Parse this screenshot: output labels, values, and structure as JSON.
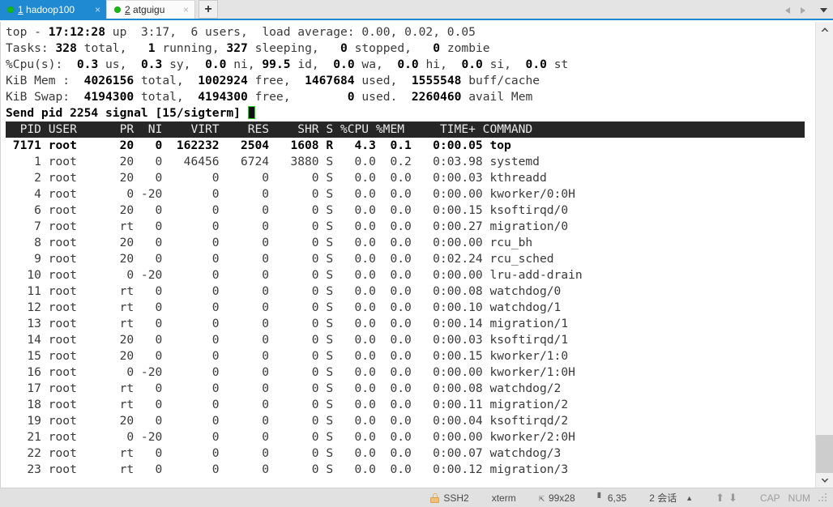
{
  "window": {
    "tabs": [
      {
        "index": "1",
        "name": "hadoop100",
        "active": true,
        "status_dot": "green",
        "close_label": "×"
      },
      {
        "index": "2",
        "name": "atguigu",
        "active": false,
        "status_dot": "green",
        "close_label": "×"
      }
    ],
    "new_tab_label": "+",
    "nav": {
      "prev_icon": "triangle-left-icon",
      "next_icon": "triangle-right-icon",
      "menu_icon": "chevron-down-icon"
    }
  },
  "terminal": {
    "summary": {
      "line1": {
        "prefix": "top - ",
        "time": "17:12:28",
        "uptime_label": " up ",
        "uptime": " 3:17,",
        "users": "  6 users,",
        "load_label": "  load average: ",
        "load": "0.00, 0.02, 0.05"
      },
      "line2": {
        "label": "Tasks:",
        "total": "328",
        "total_label": " total,",
        "running": "1",
        "running_label": " running,",
        "sleeping": "327",
        "sleeping_label": " sleeping,",
        "stopped": "0",
        "stopped_label": " stopped,",
        "zombie": "0",
        "zombie_label": " zombie"
      },
      "line3": {
        "label": "%Cpu(s):",
        "us": "0.3",
        "us_label": " us,",
        "sy": "0.3",
        "sy_label": " sy,",
        "ni": "0.0",
        "ni_label": " ni,",
        "id": "99.5",
        "id_label": " id,",
        "wa": "0.0",
        "wa_label": " wa,",
        "hi": "0.0",
        "hi_label": " hi,",
        "si": "0.0",
        "si_label": " si,",
        "st": "0.0",
        "st_label": " st"
      },
      "line4": {
        "label": "KiB Mem :",
        "total": "4026156",
        "total_label": " total,",
        "free": "1002924",
        "free_label": " free,",
        "used": "1467684",
        "used_label": " used,",
        "buff": "1555548",
        "buff_label": " buff/cache"
      },
      "line5": {
        "label": "KiB Swap:",
        "total": "4194300",
        "total_label": " total,",
        "free": "4194300",
        "free_label": " free,",
        "used": "0",
        "used_label": " used.",
        "avail": "2260460",
        "avail_label": " avail Mem"
      },
      "prompt_line": "Send pid 2254 signal [15/sigterm] "
    },
    "columns": [
      "PID",
      "USER",
      "PR",
      "NI",
      "VIRT",
      "RES",
      "SHR",
      "S",
      "%CPU",
      "%MEM",
      "TIME+",
      "COMMAND"
    ],
    "header_row": "  PID USER      PR  NI    VIRT    RES    SHR S %CPU %MEM     TIME+ COMMAND",
    "processes": [
      {
        "pid": "7171",
        "user": "root",
        "pr": "20",
        "ni": "0",
        "virt": "162232",
        "res": "2504",
        "shr": "1608",
        "s": "R",
        "cpu": "4.3",
        "mem": "0.1",
        "time": "0:00.05",
        "command": "top",
        "highlighted": true,
        "row": " 7171 root      20   0  162232   2504   1608 R   4.3  0.1   0:00.05 top"
      },
      {
        "pid": "1",
        "user": "root",
        "pr": "20",
        "ni": "0",
        "virt": "46456",
        "res": "6724",
        "shr": "3880",
        "s": "S",
        "cpu": "0.0",
        "mem": "0.2",
        "time": "0:03.98",
        "command": "systemd",
        "highlighted": false,
        "row": "    1 root      20   0   46456   6724   3880 S   0.0  0.2   0:03.98 systemd"
      },
      {
        "pid": "2",
        "user": "root",
        "pr": "20",
        "ni": "0",
        "virt": "0",
        "res": "0",
        "shr": "0",
        "s": "S",
        "cpu": "0.0",
        "mem": "0.0",
        "time": "0:00.03",
        "command": "kthreadd",
        "highlighted": false,
        "row": "    2 root      20   0       0      0      0 S   0.0  0.0   0:00.03 kthreadd"
      },
      {
        "pid": "4",
        "user": "root",
        "pr": "0",
        "ni": "-20",
        "virt": "0",
        "res": "0",
        "shr": "0",
        "s": "S",
        "cpu": "0.0",
        "mem": "0.0",
        "time": "0:00.00",
        "command": "kworker/0:0H",
        "highlighted": false,
        "row": "    4 root       0 -20       0      0      0 S   0.0  0.0   0:00.00 kworker/0:0H"
      },
      {
        "pid": "6",
        "user": "root",
        "pr": "20",
        "ni": "0",
        "virt": "0",
        "res": "0",
        "shr": "0",
        "s": "S",
        "cpu": "0.0",
        "mem": "0.0",
        "time": "0:00.15",
        "command": "ksoftirqd/0",
        "highlighted": false,
        "row": "    6 root      20   0       0      0      0 S   0.0  0.0   0:00.15 ksoftirqd/0"
      },
      {
        "pid": "7",
        "user": "root",
        "pr": "rt",
        "ni": "0",
        "virt": "0",
        "res": "0",
        "shr": "0",
        "s": "S",
        "cpu": "0.0",
        "mem": "0.0",
        "time": "0:00.27",
        "command": "migration/0",
        "highlighted": false,
        "row": "    7 root      rt   0       0      0      0 S   0.0  0.0   0:00.27 migration/0"
      },
      {
        "pid": "8",
        "user": "root",
        "pr": "20",
        "ni": "0",
        "virt": "0",
        "res": "0",
        "shr": "0",
        "s": "S",
        "cpu": "0.0",
        "mem": "0.0",
        "time": "0:00.00",
        "command": "rcu_bh",
        "highlighted": false,
        "row": "    8 root      20   0       0      0      0 S   0.0  0.0   0:00.00 rcu_bh"
      },
      {
        "pid": "9",
        "user": "root",
        "pr": "20",
        "ni": "0",
        "virt": "0",
        "res": "0",
        "shr": "0",
        "s": "S",
        "cpu": "0.0",
        "mem": "0.0",
        "time": "0:02.24",
        "command": "rcu_sched",
        "highlighted": false,
        "row": "    9 root      20   0       0      0      0 S   0.0  0.0   0:02.24 rcu_sched"
      },
      {
        "pid": "10",
        "user": "root",
        "pr": "0",
        "ni": "-20",
        "virt": "0",
        "res": "0",
        "shr": "0",
        "s": "S",
        "cpu": "0.0",
        "mem": "0.0",
        "time": "0:00.00",
        "command": "lru-add-drain",
        "highlighted": false,
        "row": "   10 root       0 -20       0      0      0 S   0.0  0.0   0:00.00 lru-add-drain"
      },
      {
        "pid": "11",
        "user": "root",
        "pr": "rt",
        "ni": "0",
        "virt": "0",
        "res": "0",
        "shr": "0",
        "s": "S",
        "cpu": "0.0",
        "mem": "0.0",
        "time": "0:00.08",
        "command": "watchdog/0",
        "highlighted": false,
        "row": "   11 root      rt   0       0      0      0 S   0.0  0.0   0:00.08 watchdog/0"
      },
      {
        "pid": "12",
        "user": "root",
        "pr": "rt",
        "ni": "0",
        "virt": "0",
        "res": "0",
        "shr": "0",
        "s": "S",
        "cpu": "0.0",
        "mem": "0.0",
        "time": "0:00.10",
        "command": "watchdog/1",
        "highlighted": false,
        "row": "   12 root      rt   0       0      0      0 S   0.0  0.0   0:00.10 watchdog/1"
      },
      {
        "pid": "13",
        "user": "root",
        "pr": "rt",
        "ni": "0",
        "virt": "0",
        "res": "0",
        "shr": "0",
        "s": "S",
        "cpu": "0.0",
        "mem": "0.0",
        "time": "0:00.14",
        "command": "migration/1",
        "highlighted": false,
        "row": "   13 root      rt   0       0      0      0 S   0.0  0.0   0:00.14 migration/1"
      },
      {
        "pid": "14",
        "user": "root",
        "pr": "20",
        "ni": "0",
        "virt": "0",
        "res": "0",
        "shr": "0",
        "s": "S",
        "cpu": "0.0",
        "mem": "0.0",
        "time": "0:00.03",
        "command": "ksoftirqd/1",
        "highlighted": false,
        "row": "   14 root      20   0       0      0      0 S   0.0  0.0   0:00.03 ksoftirqd/1"
      },
      {
        "pid": "15",
        "user": "root",
        "pr": "20",
        "ni": "0",
        "virt": "0",
        "res": "0",
        "shr": "0",
        "s": "S",
        "cpu": "0.0",
        "mem": "0.0",
        "time": "0:00.15",
        "command": "kworker/1:0",
        "highlighted": false,
        "row": "   15 root      20   0       0      0      0 S   0.0  0.0   0:00.15 kworker/1:0"
      },
      {
        "pid": "16",
        "user": "root",
        "pr": "0",
        "ni": "-20",
        "virt": "0",
        "res": "0",
        "shr": "0",
        "s": "S",
        "cpu": "0.0",
        "mem": "0.0",
        "time": "0:00.00",
        "command": "kworker/1:0H",
        "highlighted": false,
        "row": "   16 root       0 -20       0      0      0 S   0.0  0.0   0:00.00 kworker/1:0H"
      },
      {
        "pid": "17",
        "user": "root",
        "pr": "rt",
        "ni": "0",
        "virt": "0",
        "res": "0",
        "shr": "0",
        "s": "S",
        "cpu": "0.0",
        "mem": "0.0",
        "time": "0:00.08",
        "command": "watchdog/2",
        "highlighted": false,
        "row": "   17 root      rt   0       0      0      0 S   0.0  0.0   0:00.08 watchdog/2"
      },
      {
        "pid": "18",
        "user": "root",
        "pr": "rt",
        "ni": "0",
        "virt": "0",
        "res": "0",
        "shr": "0",
        "s": "S",
        "cpu": "0.0",
        "mem": "0.0",
        "time": "0:00.11",
        "command": "migration/2",
        "highlighted": false,
        "row": "   18 root      rt   0       0      0      0 S   0.0  0.0   0:00.11 migration/2"
      },
      {
        "pid": "19",
        "user": "root",
        "pr": "20",
        "ni": "0",
        "virt": "0",
        "res": "0",
        "shr": "0",
        "s": "S",
        "cpu": "0.0",
        "mem": "0.0",
        "time": "0:00.04",
        "command": "ksoftirqd/2",
        "highlighted": false,
        "row": "   19 root      20   0       0      0      0 S   0.0  0.0   0:00.04 ksoftirqd/2"
      },
      {
        "pid": "21",
        "user": "root",
        "pr": "0",
        "ni": "-20",
        "virt": "0",
        "res": "0",
        "shr": "0",
        "s": "S",
        "cpu": "0.0",
        "mem": "0.0",
        "time": "0:00.00",
        "command": "kworker/2:0H",
        "highlighted": false,
        "row": "   21 root       0 -20       0      0      0 S   0.0  0.0   0:00.00 kworker/2:0H"
      },
      {
        "pid": "22",
        "user": "root",
        "pr": "rt",
        "ni": "0",
        "virt": "0",
        "res": "0",
        "shr": "0",
        "s": "S",
        "cpu": "0.0",
        "mem": "0.0",
        "time": "0:00.07",
        "command": "watchdog/3",
        "highlighted": false,
        "row": "   22 root      rt   0       0      0      0 S   0.0  0.0   0:00.07 watchdog/3"
      },
      {
        "pid": "23",
        "user": "root",
        "pr": "rt",
        "ni": "0",
        "virt": "0",
        "res": "0",
        "shr": "0",
        "s": "S",
        "cpu": "0.0",
        "mem": "0.0",
        "time": "0:00.12",
        "command": "migration/3",
        "highlighted": false,
        "row": "   23 root      rt   0       0      0      0 S   0.0  0.0   0:00.12 migration/3"
      }
    ]
  },
  "statusbar": {
    "protocol": "SSH2",
    "terminal_type": "xterm",
    "size": "99x28",
    "cursor_position": "6,35",
    "sessions": "2 会话",
    "cap": "CAP",
    "num": "NUM",
    "icons": {
      "lock": "lock-icon",
      "size": "terminal-size-icon",
      "cursor": "cursor-position-icon",
      "sessions_caret": "chevron-up-icon",
      "upload": "upload-arrow-icon",
      "download": "download-arrow-icon"
    }
  },
  "colors": {
    "accent": "#1f8ad2",
    "header_row_bg": "#262626",
    "cursor_outline": "#27d427",
    "status_dot": "#16b916"
  }
}
